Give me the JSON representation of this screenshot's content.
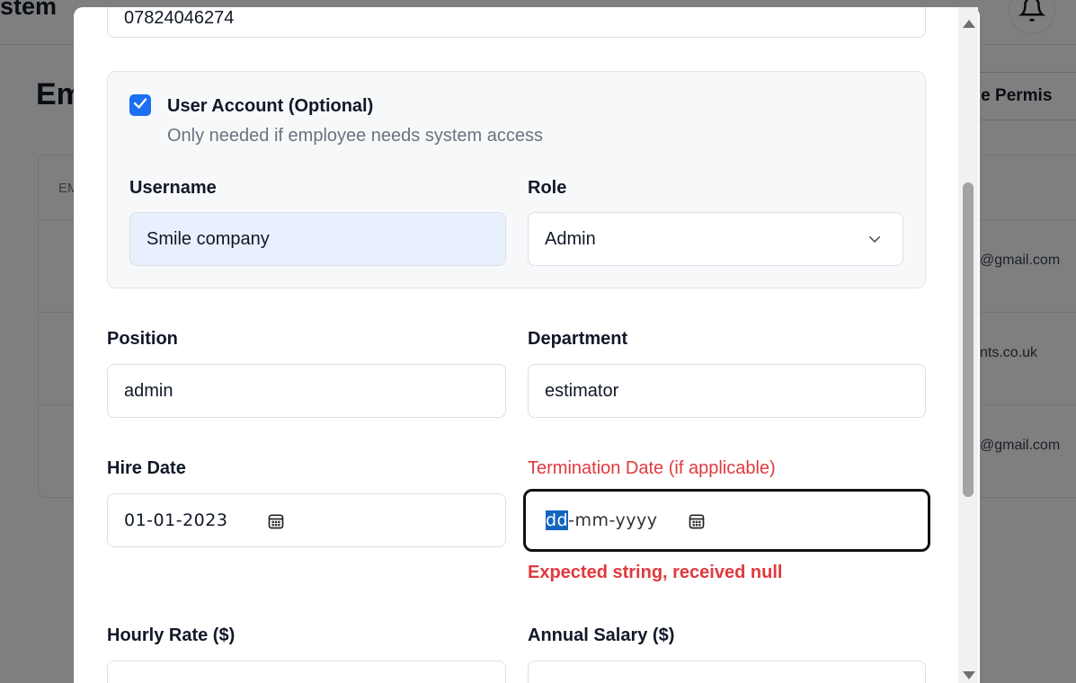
{
  "background": {
    "brand_fragment": "stem",
    "heading_fragment": "Em",
    "permissions_button_fragment": "age Permis",
    "table_header_fragment": "EM",
    "row_emails": [
      "@gmail.com",
      "nts.co.uk",
      "@gmail.com"
    ]
  },
  "form": {
    "phone_value": "07824046274",
    "user_account": {
      "checked": true,
      "title": "User Account (Optional)",
      "subtitle": "Only needed if employee needs system access",
      "username_label": "Username",
      "username_value": "Smile company",
      "role_label": "Role",
      "role_value": "Admin"
    },
    "position_label": "Position",
    "position_value": "admin",
    "department_label": "Department",
    "department_value": "estimator",
    "hire_date_label": "Hire Date",
    "hire_date_value": "01-01-2023",
    "termination_label": "Termination Date (if applicable)",
    "termination_placeholder_dd": "dd",
    "termination_placeholder_rest": "-mm-yyyy",
    "termination_error": "Expected string, received null",
    "hourly_rate_label": "Hourly Rate ($)",
    "annual_salary_label": "Annual Salary ($)"
  },
  "colors": {
    "accent": "#1d6ff2",
    "error": "#e0393e",
    "selection": "#1565c0"
  }
}
